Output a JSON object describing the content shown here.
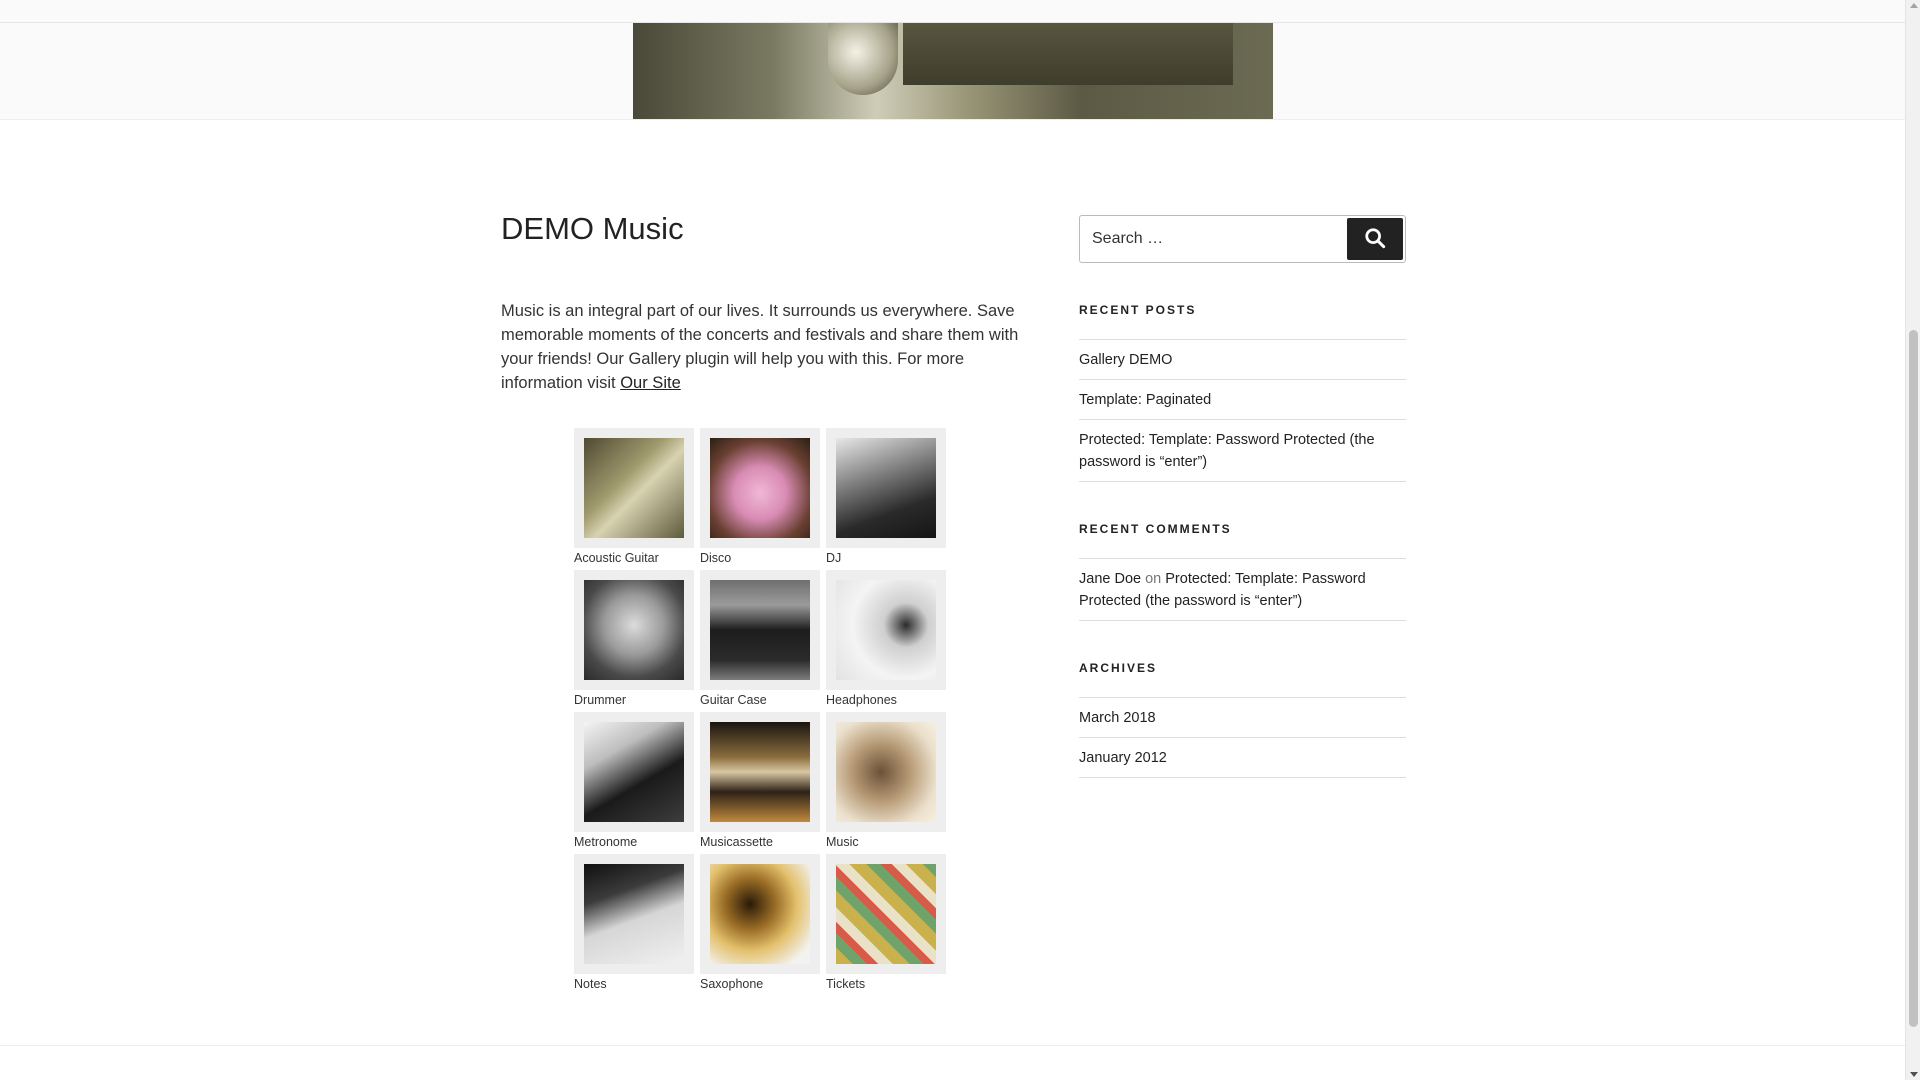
{
  "page": {
    "title": "DEMO Music",
    "intro_text": "Music is an integral part of our lives. It surrounds us everywhere. Save memorable moments of the concerts and festivals and share them with your friends! Our Gallery plugin will help you with this. For more information visit ",
    "intro_link": "Our Site"
  },
  "gallery": {
    "rows": [
      [
        {
          "caption": "Acoustic Guitar"
        },
        {
          "caption": "Disco"
        },
        {
          "caption": "DJ"
        }
      ],
      [
        {
          "caption": "Drummer"
        },
        {
          "caption": "Guitar Case"
        },
        {
          "caption": "Headphones"
        }
      ],
      [
        {
          "caption": "Metronome"
        },
        {
          "caption": "Musicassette"
        },
        {
          "caption": "Music"
        }
      ],
      [
        {
          "caption": "Notes"
        },
        {
          "caption": "Saxophone"
        },
        {
          "caption": "Tickets"
        }
      ]
    ]
  },
  "sidebar": {
    "search": {
      "placeholder": "Search …",
      "button_icon": "search-icon"
    },
    "recent_posts": {
      "title": "RECENT POSTS",
      "items": [
        {
          "label": "Gallery DEMO"
        },
        {
          "label": "Template: Paginated"
        },
        {
          "label": "Protected: Template: Password Protected (the password is “enter”)"
        }
      ]
    },
    "recent_comments": {
      "title": "RECENT COMMENTS",
      "items": [
        {
          "author": "Jane Doe",
          "on": " on ",
          "post": "Protected: Template: Password Protected (the password is “enter”)"
        }
      ]
    },
    "archives": {
      "title": "ARCHIVES",
      "items": [
        {
          "label": "March 2018"
        },
        {
          "label": "January 2012"
        }
      ]
    }
  },
  "colors": {
    "text": "#333333",
    "heading": "#222222",
    "button": "#222222",
    "divider": "#dddddd"
  }
}
